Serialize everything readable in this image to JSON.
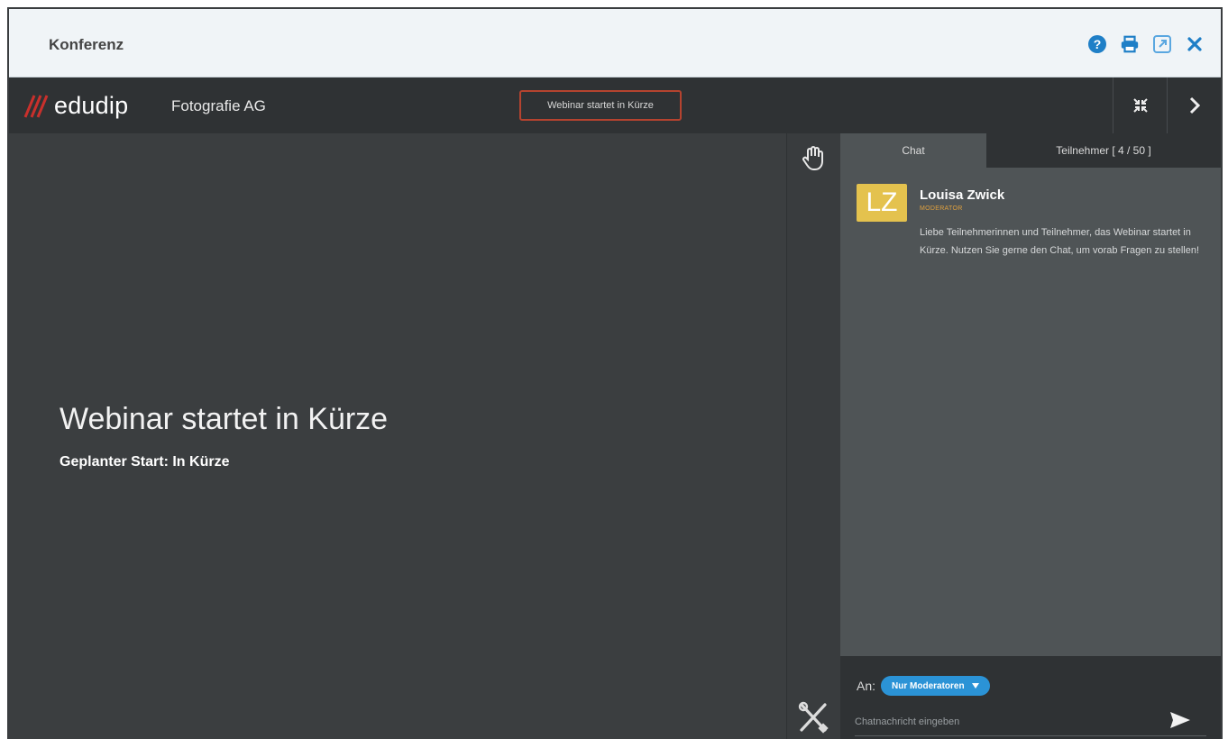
{
  "window": {
    "title": "Konferenz",
    "icons": [
      "help-icon",
      "print-icon",
      "popout-icon",
      "close-icon"
    ]
  },
  "topbar": {
    "logo_text": "edudip",
    "company": "Fotografie AG",
    "status": "Webinar startet in Kürze",
    "icons": [
      "fullscreen-icon",
      "chevron-right-icon"
    ]
  },
  "stage": {
    "headline": "Webinar startet in Kürze",
    "subline": "Geplanter Start: In Kürze"
  },
  "tools": {
    "icons": [
      "hand-raise-icon",
      "tools-icon"
    ]
  },
  "sidebar": {
    "tabs": [
      {
        "label": "Chat",
        "active": true
      },
      {
        "label": "Teilnehmer [ 4 / 50 ]",
        "active": false
      }
    ],
    "messages": [
      {
        "initials": "LZ",
        "author": "Louisa Zwick",
        "role": "MODERATOR",
        "text": "Liebe Teilnehmerinnen und Teilnehmer, das Webinar startet in Kürze. Nutzen Sie gerne den Chat, um vorab Fragen zu stellen!"
      }
    ],
    "composer": {
      "to_label": "An:",
      "recipient": "Nur Moderatoren",
      "placeholder": "Chatnachricht eingeben"
    }
  },
  "colors": {
    "accent_blue": "#2b93d6",
    "brand_red": "#c9302c",
    "avatar_yellow": "#e4c24e",
    "status_border": "#b5432f"
  }
}
